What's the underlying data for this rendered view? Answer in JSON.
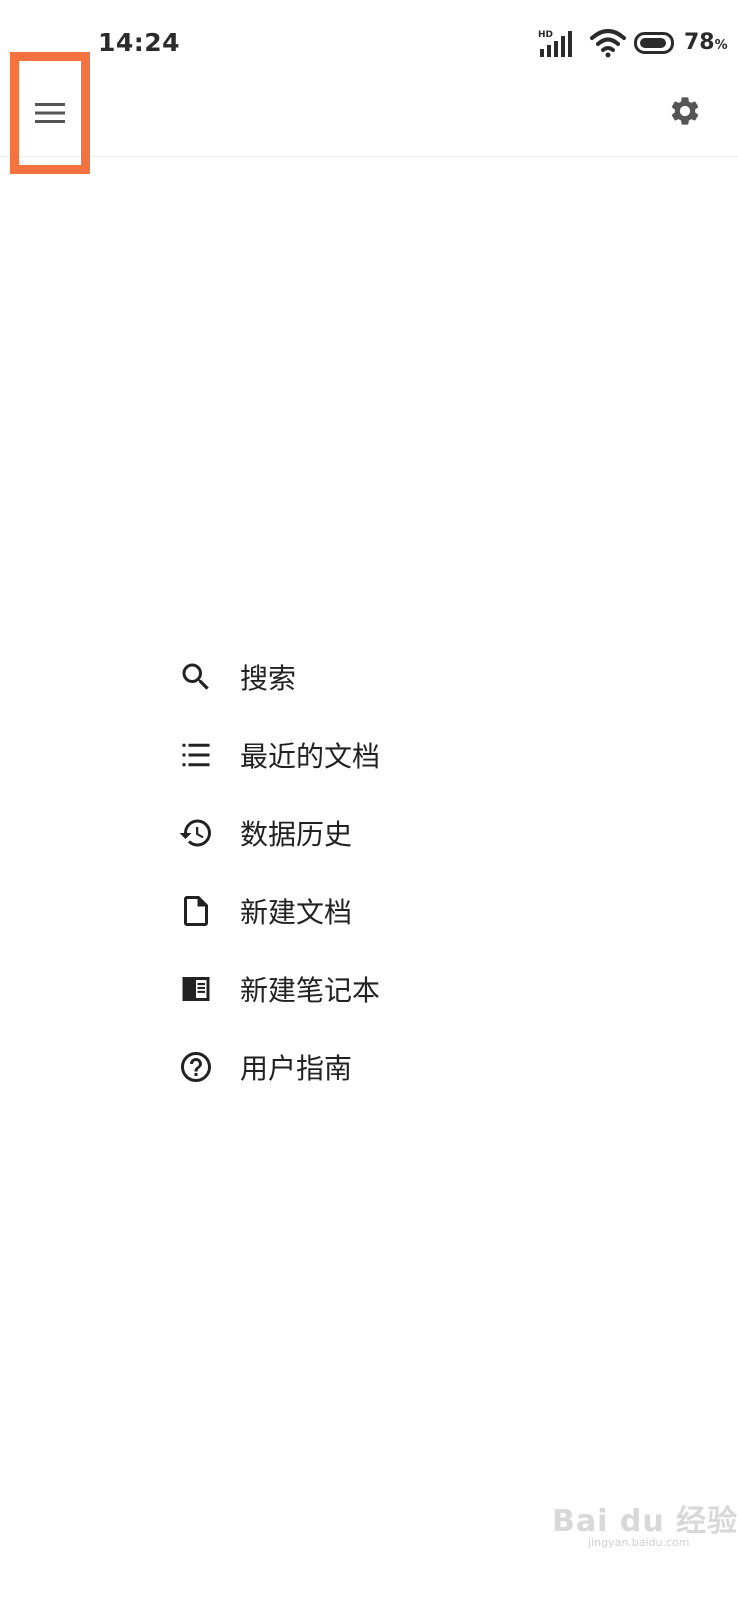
{
  "status_bar": {
    "time": "14:24",
    "network_label": "HD",
    "battery_value": "78",
    "battery_unit": "%"
  },
  "app_bar": {
    "menu_icon": "hamburger-menu-icon",
    "settings_icon": "gear-icon",
    "highlight_color": "#f47140"
  },
  "menu": {
    "items": [
      {
        "icon": "search-icon",
        "label": "搜索"
      },
      {
        "icon": "list-icon",
        "label": "最近的文档"
      },
      {
        "icon": "history-icon",
        "label": "数据历史"
      },
      {
        "icon": "document-icon",
        "label": "新建文档"
      },
      {
        "icon": "notebook-icon",
        "label": "新建笔记本"
      },
      {
        "icon": "help-icon",
        "label": "用户指南"
      }
    ]
  },
  "watermark": {
    "text": "Bai du 经验",
    "sub": "jingyan.baidu.com"
  }
}
